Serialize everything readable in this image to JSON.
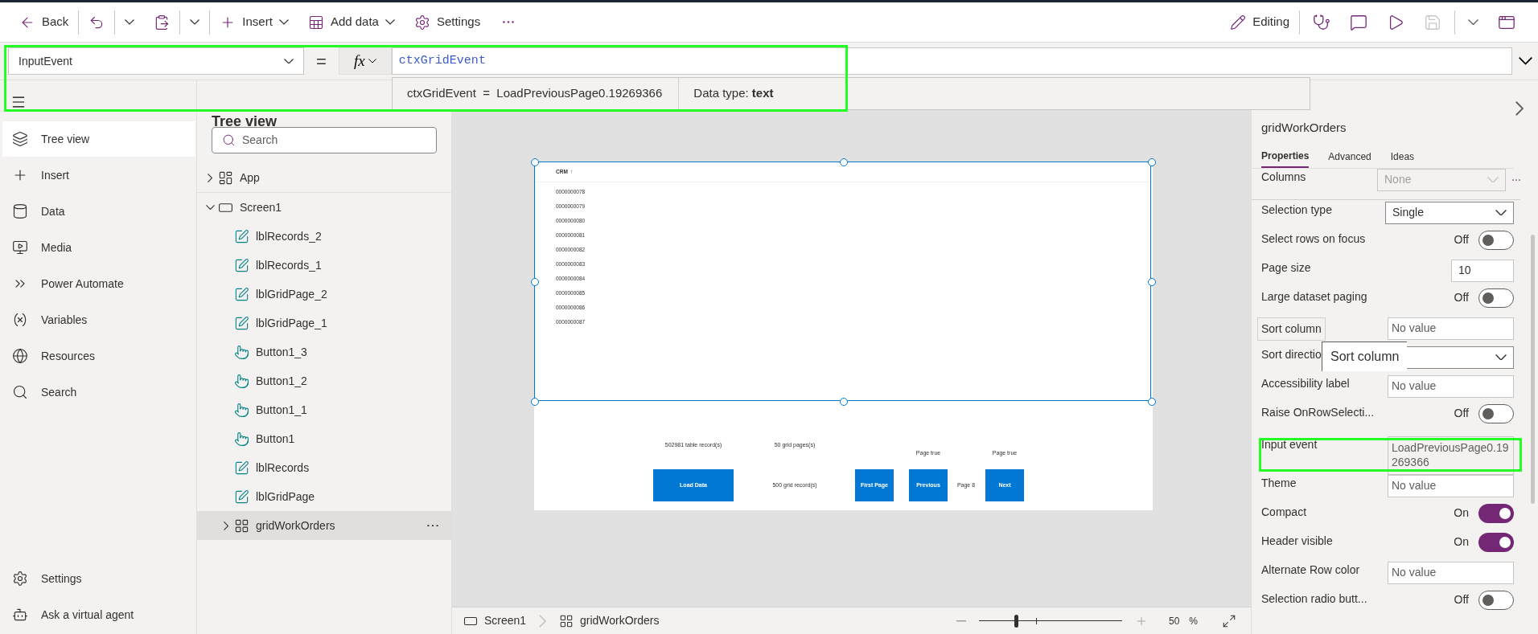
{
  "toolbar": {
    "back": "Back",
    "insert": "Insert",
    "add_data": "Add data",
    "settings": "Settings",
    "editing": "Editing",
    "save": {
      "disabled": true
    }
  },
  "formula_bar": {
    "property": "InputEvent",
    "equals": "=",
    "fx": "fx",
    "formula": "ctxGridEvent",
    "hint": {
      "expression": "ctxGridEvent  =  LoadPreviousPage0.19269366",
      "data_type": "Data type: **text**"
    }
  },
  "nav": {
    "items": [
      {
        "label": "Tree view",
        "kind": "layers",
        "selected": true
      },
      {
        "label": "Insert",
        "kind": "plus",
        "selected": false
      },
      {
        "label": "Data",
        "kind": "data",
        "selected": false
      },
      {
        "label": "Media",
        "kind": "media",
        "selected": false
      },
      {
        "label": "Power Automate",
        "kind": "flow",
        "selected": false
      },
      {
        "label": "Variables",
        "kind": "variable",
        "selected": false
      },
      {
        "label": "Resources",
        "kind": "resources",
        "selected": false
      },
      {
        "label": "Search",
        "kind": "search",
        "selected": false
      }
    ],
    "bottom": [
      {
        "label": "Settings",
        "kind": "settings",
        "selected": false
      },
      {
        "label": "Ask a virtual agent",
        "kind": "bot",
        "selected": false
      }
    ]
  },
  "tree": {
    "title": "Tree view",
    "search": {
      "placeholder": "Search"
    },
    "nodes": [
      {
        "name": "App",
        "kind": "app",
        "expanded": false,
        "selected": false
      },
      {
        "name": "Screen1",
        "kind": "screen",
        "expanded": true,
        "selected": false,
        "children": [
          {
            "name": "lblRecords_2",
            "kind": "label",
            "selected": false
          },
          {
            "name": "lblRecords_1",
            "kind": "label",
            "selected": false
          },
          {
            "name": "lblGridPage_2",
            "kind": "label",
            "selected": false
          },
          {
            "name": "lblGridPage_1",
            "kind": "label",
            "selected": false
          },
          {
            "name": "Button1_3",
            "kind": "button",
            "selected": false
          },
          {
            "name": "Button1_2",
            "kind": "button",
            "selected": false
          },
          {
            "name": "Button1_1",
            "kind": "button",
            "selected": false
          },
          {
            "name": "Button1",
            "kind": "button",
            "selected": false
          },
          {
            "name": "lblRecords",
            "kind": "label",
            "selected": false
          },
          {
            "name": "lblGridPage",
            "kind": "label",
            "selected": false
          },
          {
            "name": "gridWorkOrders",
            "kind": "grid",
            "expanded": false,
            "selected": true
          }
        ]
      }
    ]
  },
  "canvas": {
    "grid": {
      "header": "CRM",
      "sort_indicator": "↑",
      "rows": [
        "0000000078",
        "0000000079",
        "0000000080",
        "0000000081",
        "0000000082",
        "0000000083",
        "0000000084",
        "0000000085",
        "0000000086",
        "0000000087"
      ]
    },
    "labels": [
      "502981 table record(s)",
      "50 grid pages(s)",
      "Page true",
      "Page true",
      "500 grid record(s)",
      "Page 8"
    ],
    "buttons": [
      "Load Data",
      "First Page",
      "Previous",
      "Next"
    ]
  },
  "status_bar": {
    "breadcrumbs": [
      {
        "label": "Screen1",
        "kind": "screen"
      },
      {
        "label": "gridWorkOrders",
        "kind": "grid"
      }
    ],
    "zoom": {
      "level": 0.26,
      "percent": "50",
      "unit": "%"
    }
  },
  "properties_panel": {
    "control": "gridWorkOrders",
    "tabs": [
      {
        "label": "Properties",
        "selected": true
      },
      {
        "label": "Advanced",
        "selected": false
      },
      {
        "label": "Ideas",
        "selected": false
      }
    ],
    "rows": [
      {
        "kind": "dropdown",
        "label": "Columns",
        "value": "None",
        "disabled": true,
        "hovered": false
      },
      {
        "kind": "dropdown",
        "label": "Selection type",
        "value": "Single",
        "disabled": false,
        "hovered": false
      },
      {
        "kind": "toggle",
        "label": "Select rows on focus",
        "on": false,
        "state": "Off",
        "hovered": false
      },
      {
        "kind": "number",
        "label": "Page size",
        "value": "10",
        "hovered": false
      },
      {
        "kind": "toggle",
        "label": "Large dataset paging",
        "on": false,
        "state": "Off",
        "hovered": false
      },
      {
        "kind": "input",
        "label": "Sort column",
        "placeholder": "No value",
        "hovered": true
      },
      {
        "kind": "dropdown",
        "label": "Sort directio",
        "disabled": false,
        "hovered": false
      },
      {
        "kind": "input",
        "label": "Accessibility label",
        "placeholder": "No value",
        "hovered": false
      },
      {
        "kind": "toggle",
        "label": "Raise OnRowSelecti...",
        "on": false,
        "state": "Off",
        "hovered": false
      },
      {
        "kind": "formula",
        "label": "Input event",
        "value": "LoadPreviousPage0.19269366",
        "hovered": false
      },
      {
        "kind": "input",
        "label": "Theme",
        "placeholder": "No value",
        "hovered": false
      },
      {
        "kind": "toggle",
        "label": "Compact",
        "on": true,
        "state": "On",
        "hovered": false
      },
      {
        "kind": "toggle",
        "label": "Header visible",
        "on": true,
        "state": "On",
        "hovered": false
      },
      {
        "kind": "input",
        "label": "Alternate Row color",
        "placeholder": "No value",
        "hovered": false
      },
      {
        "kind": "toggle",
        "label": "Selection radio butt...",
        "on": false,
        "state": "Off",
        "hovered": false
      }
    ],
    "tooltip": "Sort column"
  }
}
